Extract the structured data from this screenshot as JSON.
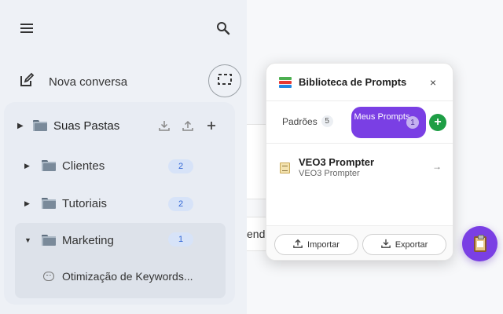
{
  "sidebar": {
    "new_chat_label": "Nova conversa",
    "root_folder": {
      "label": "Suas Pastas"
    },
    "folders": [
      {
        "label": "Clientes",
        "count": "2"
      },
      {
        "label": "Tutoriais",
        "count": "2"
      },
      {
        "label": "Marketing",
        "count": "1"
      }
    ],
    "marketing_chat": "Otimização de Keywords..."
  },
  "background": {
    "partial_text": "ender"
  },
  "popup": {
    "title": "Biblioteca de Prompts",
    "close": "×",
    "tabs": {
      "default_label": "Padrões",
      "default_count": "5",
      "mine_label": "Meus Prompts",
      "mine_count": "1"
    },
    "add": "+",
    "prompt": {
      "title": "VEO3 Prompter",
      "subtitle": "VEO3 Prompter",
      "arrow": "→"
    },
    "import_label": "Importar",
    "export_label": "Exportar"
  },
  "colors": {
    "accent": "#7a3fe4",
    "add_green": "#1e9e45",
    "badge_bg": "#d7e3f8",
    "badge_text": "#3367d6"
  },
  "icons": {
    "menu": "menu-icon",
    "search": "search-icon",
    "edit": "edit-icon",
    "focus": "focus-frame-icon",
    "download": "download-icon",
    "upload": "upload-icon",
    "add": "plus-icon",
    "books": "books-icon",
    "note": "memo-icon",
    "clipboard": "clipboard-icon"
  }
}
